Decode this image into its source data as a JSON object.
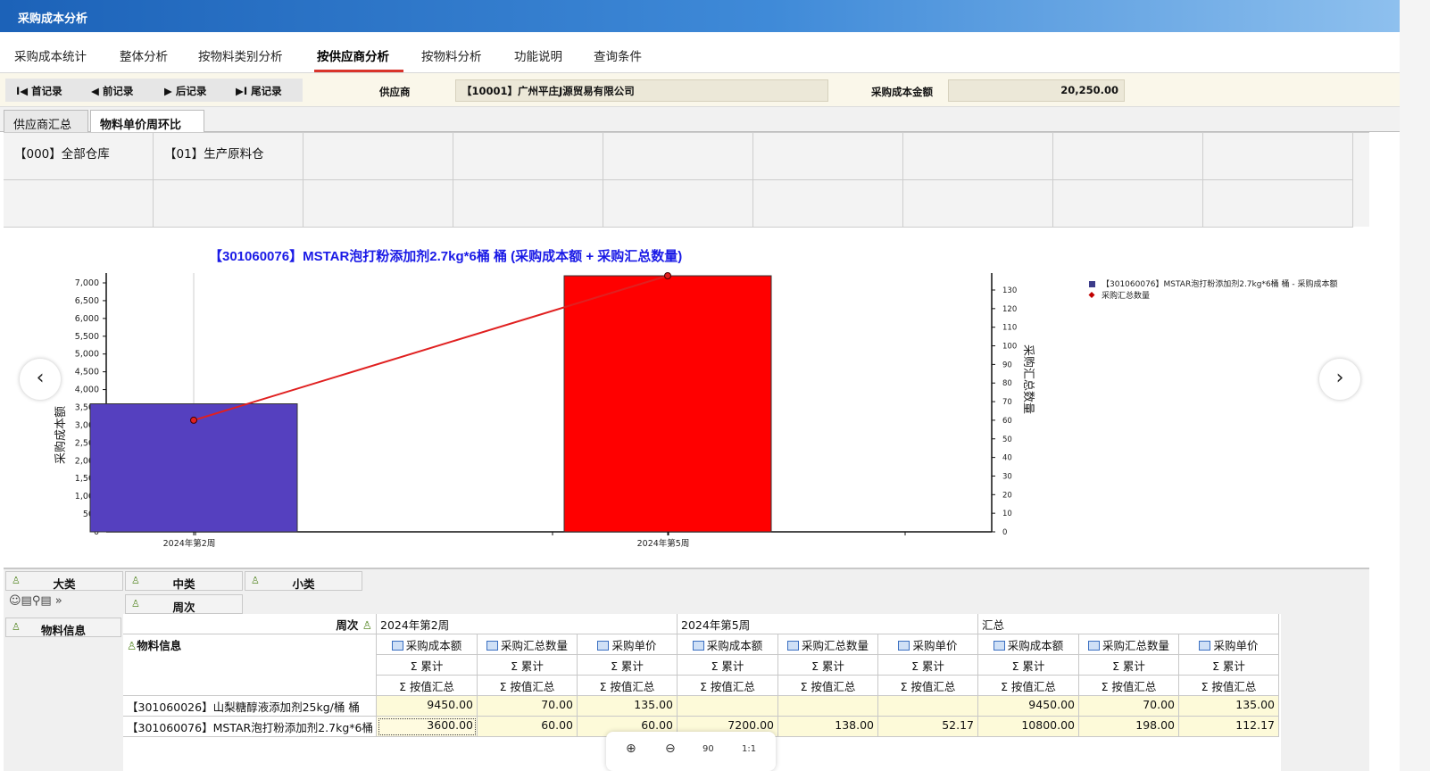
{
  "app": {
    "title": "采购成本分析"
  },
  "topnav": {
    "tabs": [
      {
        "label": "采购成本统计"
      },
      {
        "label": "整体分析"
      },
      {
        "label": "按物料类别分析"
      },
      {
        "label": "按供应商分析"
      },
      {
        "label": "按物料分析"
      },
      {
        "label": "功能说明"
      },
      {
        "label": "查询条件"
      }
    ],
    "active_index": 3
  },
  "toolbar": {
    "first": "I◀ 首记录",
    "prev": "◀ 前记录",
    "next": "▶ 后记录",
    "last": "▶I 尾记录",
    "supplier_label": "供应商",
    "supplier_value": "【10001】广州平庄J源贸易有限公司",
    "amount_label": "采购成本金额",
    "amount_value": "20,250.00"
  },
  "subtabs": [
    {
      "label": "供应商汇总"
    },
    {
      "label": "物料单价周环比"
    }
  ],
  "warehouses": [
    "【000】全部仓库",
    "【01】生产原料仓"
  ],
  "chart_data": {
    "type": "bar+line",
    "title": "【301060076】MSTAR泡打粉添加剂2.7kg*6桶 桶 (采购成本额 + 采购汇总数量)",
    "categories": [
      "2024年第2周",
      "2024年第5周"
    ],
    "series": [
      {
        "name": "【301060076】MSTAR泡打粉添加剂2.7kg*6桶 桶 - 采购成本额",
        "type": "bar",
        "axis": "left",
        "values": [
          3600,
          7200
        ],
        "colors": [
          "#5540bf",
          "#ff0000"
        ]
      },
      {
        "name": "采购汇总数量",
        "type": "line",
        "axis": "right",
        "values": [
          60,
          138
        ],
        "color": "#e02020"
      }
    ],
    "ylabel": "采购成本额",
    "y2label": "采购汇总数量",
    "ylim": [
      0,
      7000
    ],
    "y2lim": [
      0,
      130
    ],
    "yticks": [
      "0",
      "500",
      "1,000",
      "1,500",
      "2,000",
      "2,500",
      "3,000",
      "3,500",
      "4,000",
      "4,500",
      "5,000",
      "5,500",
      "6,000",
      "6,500",
      "7,000"
    ],
    "y2ticks": [
      "0",
      "10",
      "20",
      "30",
      "40",
      "50",
      "60",
      "70",
      "80",
      "90",
      "100",
      "110",
      "120",
      "130"
    ],
    "legend_position": "top-right",
    "legend": [
      "【301060076】MSTAR泡打粉添加剂2.7kg*6桶 桶 - 采购成本额",
      "采购汇总数量"
    ]
  },
  "pivot": {
    "fields_row1": [
      "大类",
      "中类",
      "小类"
    ],
    "fields_row2": [
      "周次"
    ],
    "row_field": "物料信息",
    "col_field": "周次",
    "col_groups": [
      "2024年第2周",
      "2024年第5周",
      "汇总"
    ],
    "measures": [
      "采购成本额",
      "采购汇总数量",
      "采购单价"
    ],
    "agg1": "Σ 累计",
    "agg2": "Σ 按值汇总",
    "row_header": "物料信息",
    "rows": [
      {
        "label": "【301060026】山梨糖醇液添加剂25kg/桶 桶",
        "values": [
          "9450.00",
          "70.00",
          "135.00",
          "",
          "",
          "",
          "9450.00",
          "70.00",
          "135.00"
        ]
      },
      {
        "label": "【301060076】MSTAR泡打粉添加剂2.7kg*6桶 桶",
        "values": [
          "3600.00",
          "60.00",
          "60.00",
          "7200.00",
          "138.00",
          "52.17",
          "10800.00",
          "198.00",
          "112.17"
        ]
      }
    ]
  },
  "zoom": {
    "zoom_in": "⊕",
    "zoom_out": "⊖",
    "rotate": "90",
    "actual": "1:1"
  }
}
